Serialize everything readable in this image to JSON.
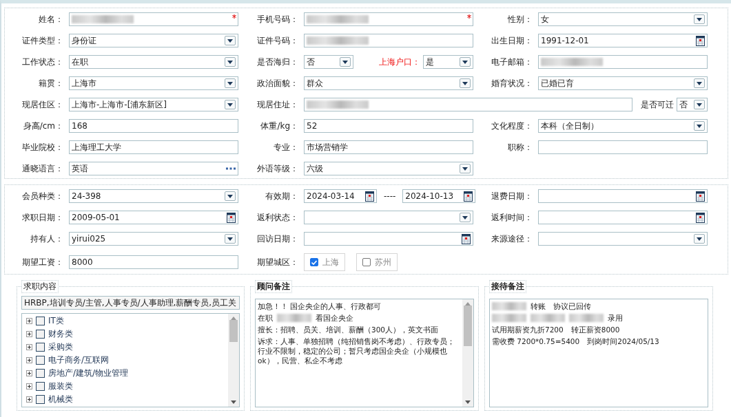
{
  "form": {
    "rows": [
      [
        {
          "label": "姓名：",
          "kind": "text",
          "redacted": true,
          "required": true
        },
        {
          "label": "手机号码：",
          "kind": "text",
          "redacted": true,
          "required": true
        },
        {
          "label": "性别：",
          "kind": "select",
          "value": "女"
        }
      ],
      [
        {
          "label": "证件类型：",
          "kind": "select",
          "value": "身份证"
        },
        {
          "label": "证件号码：",
          "kind": "text",
          "redacted": true
        },
        {
          "label": "出生日期：",
          "kind": "date",
          "value": "1991-12-01"
        }
      ],
      [
        {
          "label": "工作状态：",
          "kind": "select",
          "value": "在职"
        },
        {
          "label": "是否海归：",
          "kind": "pair",
          "value": "否",
          "second": {
            "label": "上海户口：",
            "value": "是",
            "alert": true
          }
        },
        {
          "label": "电子邮箱：",
          "kind": "text",
          "redacted": true
        }
      ],
      [
        {
          "label": "籍贯：",
          "kind": "select",
          "value": "上海市"
        },
        {
          "label": "政治面貌：",
          "kind": "select",
          "value": "群众"
        },
        {
          "label": "婚育状况：",
          "kind": "select",
          "value": "已婚已育"
        }
      ],
      [
        {
          "label": "现居住区：",
          "kind": "select",
          "value": "上海市-上海市-[浦东新区]"
        },
        {
          "label": "现居住址：",
          "kind": "address",
          "redacted": true,
          "second": {
            "label": "是否可迁",
            "value": "否"
          }
        }
      ],
      [
        {
          "label": "身高/cm：",
          "kind": "text",
          "value": "168"
        },
        {
          "label": "体重/kg：",
          "kind": "text",
          "value": "52"
        },
        {
          "label": "文化程度：",
          "kind": "select",
          "value": "本科（全日制）"
        }
      ],
      [
        {
          "label": "毕业院校：",
          "kind": "text",
          "value": "上海理工大学"
        },
        {
          "label": "专业：",
          "kind": "text",
          "value": "市场营销学"
        },
        {
          "label": "职称：",
          "kind": "text"
        }
      ],
      [
        {
          "label": "通晓语言：",
          "kind": "lookup",
          "value": "英语"
        },
        {
          "label": "外语等级：",
          "kind": "select",
          "value": "六级"
        }
      ]
    ]
  },
  "membership": {
    "rows": [
      [
        {
          "label": "会员种类：",
          "kind": "select",
          "value": "24-398"
        },
        {
          "label": "有效期：",
          "kind": "daterange",
          "from": "2024-03-14",
          "separator": "----",
          "to": "2024-10-13"
        },
        {
          "label": "退费日期：",
          "kind": "date"
        }
      ],
      [
        {
          "label": "求职日期：",
          "kind": "date",
          "value": "2009-05-01"
        },
        {
          "label": "返利状态：",
          "kind": "select"
        },
        {
          "label": "返利时间：",
          "kind": "date"
        }
      ],
      [
        {
          "label": "持有人：",
          "kind": "select",
          "value": "yirui025"
        },
        {
          "label": "回访日期：",
          "kind": "date"
        },
        {
          "label": "来源途径：",
          "kind": "select"
        }
      ],
      [
        {
          "label": "期望工资：",
          "kind": "text",
          "value": "8000"
        },
        {
          "label": "期望城区：",
          "kind": "checkgroup",
          "options": [
            {
              "label": "上海",
              "checked": true
            },
            {
              "label": "苏州",
              "checked": false
            }
          ]
        }
      ]
    ]
  },
  "panels": [
    {
      "kind": "tree",
      "title": "求职内容",
      "summary": "HRBP,培训专员/主管,人事专员/人事助理,薪酬专员,员工关",
      "items": [
        {
          "label": "IT类",
          "checked": false,
          "expanded": false
        },
        {
          "label": "财务类",
          "checked": false,
          "expanded": false
        },
        {
          "label": "采购类",
          "checked": false,
          "expanded": false
        },
        {
          "label": "电子商务/互联网",
          "checked": false,
          "expanded": false
        },
        {
          "label": "房地产/建筑/物业管理",
          "checked": false,
          "expanded": false
        },
        {
          "label": "服装类",
          "checked": false,
          "expanded": false
        },
        {
          "label": "机械类",
          "checked": false,
          "expanded": false
        }
      ]
    },
    {
      "kind": "note",
      "title": "顾问备注",
      "scrollbar": true,
      "paragraphs": [
        [
          {
            "text": "加急！！ 国企央企的人事、行政都可"
          }
        ],
        [
          {
            "text": "在职"
          },
          {
            "redacted": true
          },
          {
            "text": "看国企央企"
          }
        ],
        [
          {
            "text": "擅长：招聘、员关、培训、薪酬（300人），英文书面"
          }
        ],
        [
          {
            "text": "诉求：人事、单独招聘（纯招销售岗不考虑）、行政专员；行业不限制，稳定的公司；暂只考虑国企央企（小规模也ok），民营、私企不考虑"
          }
        ]
      ]
    },
    {
      "kind": "note",
      "title": "接待备注",
      "scrollbar": false,
      "paragraphs": [
        [
          {
            "redacted": true
          },
          {
            "text": "转账　协议已回传"
          }
        ],
        [
          {
            "redacted": true
          },
          {
            "redacted": true
          },
          {
            "redacted": true
          },
          {
            "text": "录用"
          }
        ],
        [
          {
            "text": "试用期薪资九折7200　转正薪资8000"
          }
        ],
        [
          {
            "text": "需收费 7200*0.75=5400　到岗时间2024/05/13"
          }
        ]
      ]
    }
  ]
}
